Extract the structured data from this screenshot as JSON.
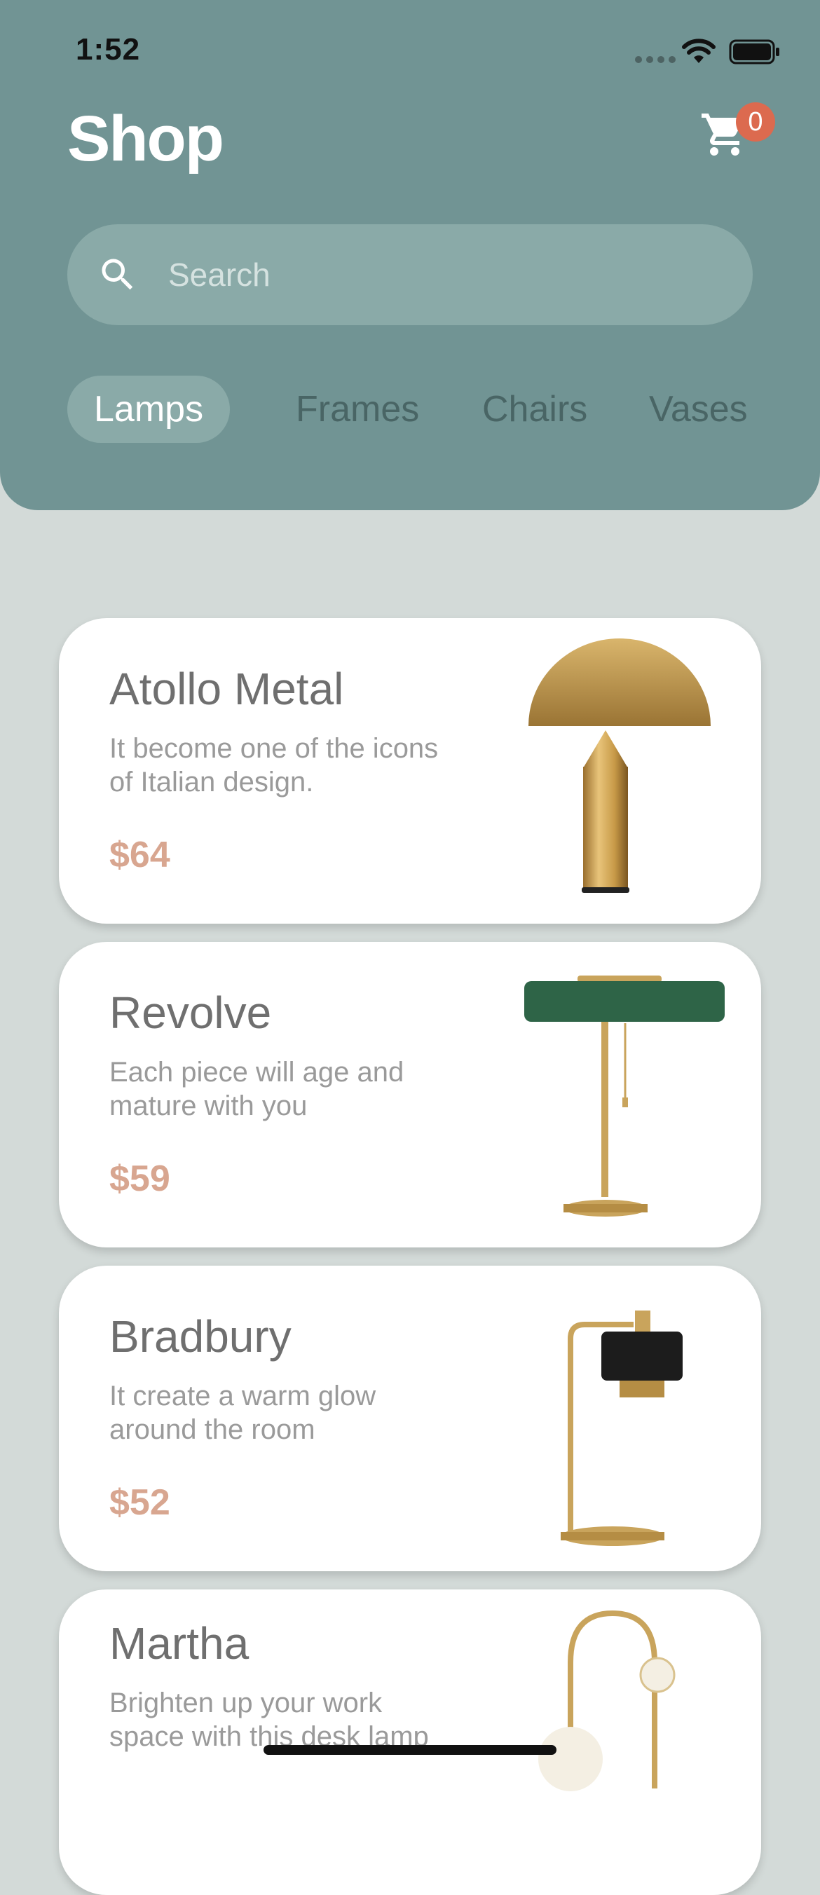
{
  "status_bar": {
    "time": "1:52"
  },
  "header": {
    "title": "Shop",
    "cart_count": "0"
  },
  "search": {
    "placeholder": "Search",
    "value": ""
  },
  "categories": [
    {
      "label": "Lamps",
      "active": true
    },
    {
      "label": "Frames",
      "active": false
    },
    {
      "label": "Chairs",
      "active": false
    },
    {
      "label": "Vases",
      "active": false
    }
  ],
  "products": [
    {
      "name": "Atollo Metal",
      "description": "It become one of the icons of Italian design.",
      "price": "$64",
      "icon": "gold-dome-lamp"
    },
    {
      "name": "Revolve",
      "description": "Each piece will age and mature with you",
      "price": "$59",
      "icon": "green-shade-lamp"
    },
    {
      "name": "Bradbury",
      "description": "It create a warm glow around the room",
      "price": "$52",
      "icon": "black-shade-desk-lamp"
    },
    {
      "name": "Martha",
      "description": "Brighten up your work space with this desk lamp",
      "price": "",
      "icon": "globe-arc-lamp"
    }
  ],
  "colors": {
    "header": "#719494",
    "background": "#d3dad8",
    "badge": "#dc6a4f",
    "price": "#d8a690"
  }
}
